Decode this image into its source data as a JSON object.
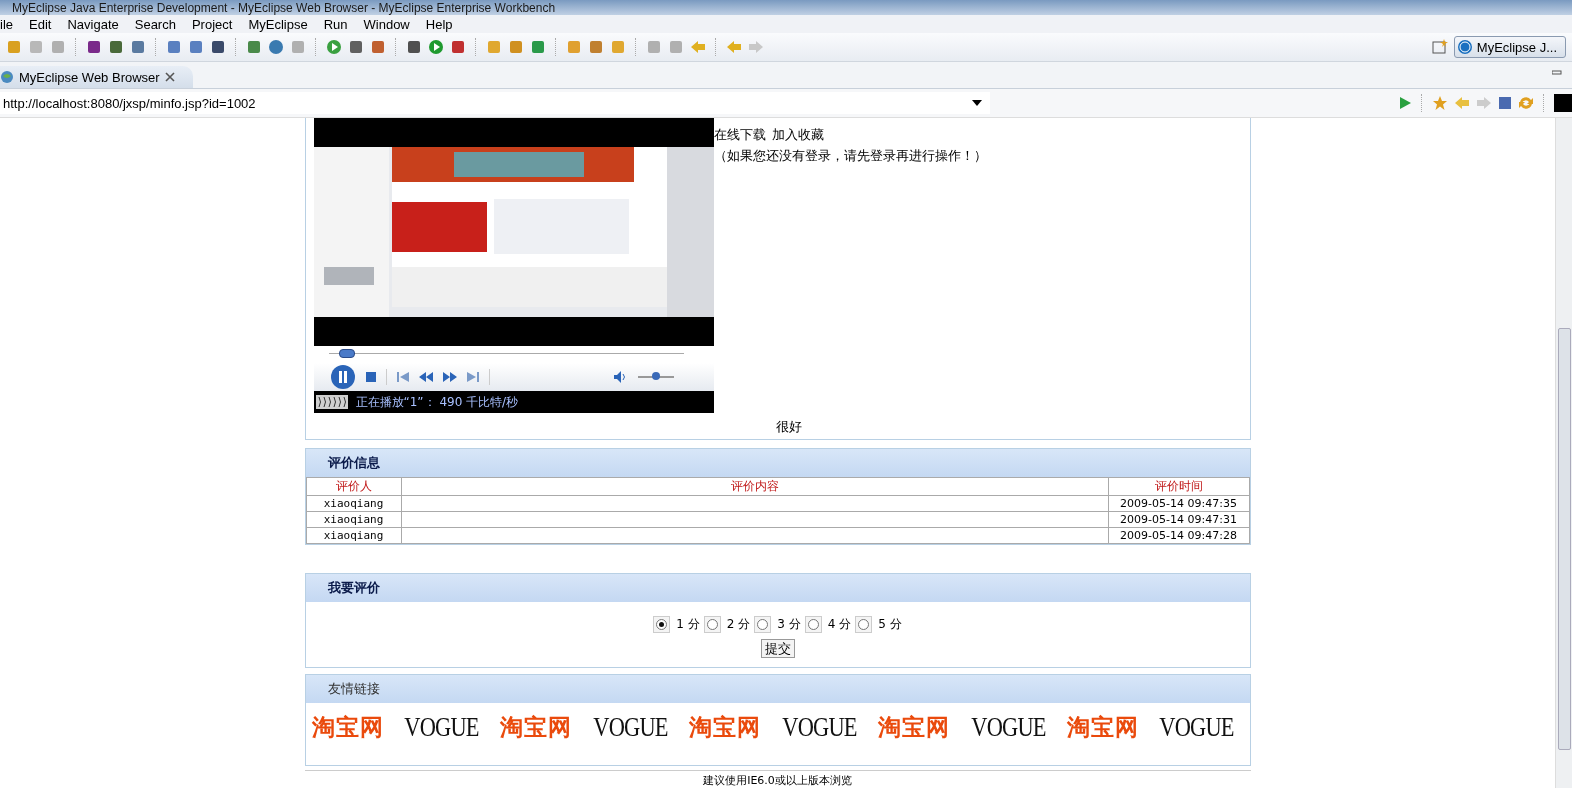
{
  "window": {
    "title": "MyEclipse Java Enterprise Development - MyEclipse Web Browser - MyEclipse Enterprise Workbench"
  },
  "menu": [
    "ile",
    "Edit",
    "Navigate",
    "Search",
    "Project",
    "MyEclipse",
    "Run",
    "Window",
    "Help"
  ],
  "perspective": {
    "label": "MyEclipse J..."
  },
  "editor_tab": {
    "label": "MyEclipse Web Browser"
  },
  "address_bar": {
    "value": "http://localhost:8080/jxsp/minfo.jsp?id=1002"
  },
  "page": {
    "actions": [
      "在线下载",
      "加入收藏"
    ],
    "login_note": "（如果您还没有登录，请先登录再进行操作！）",
    "player": {
      "playing": true,
      "seek": {
        "level": 0.03
      },
      "volume": {
        "level": 0.5
      },
      "status": "正在播放“1”： 490 千比特/秒"
    },
    "review_text": "很好",
    "reviews": {
      "title": "评价信息",
      "columns": [
        "评价人",
        "评价内容",
        "评价时间"
      ],
      "rows": [
        {
          "reviewer": "xiaoqiang",
          "time": "2009-05-14 09:47:35"
        },
        {
          "reviewer": "xiaoqiang",
          "time": "2009-05-14 09:47:31"
        },
        {
          "reviewer": "xiaoqiang",
          "time": "2009-05-14 09:47:28"
        }
      ]
    },
    "rate": {
      "title": "我要评价",
      "options": [
        {
          "label": "1 分",
          "selected": true
        },
        {
          "label": "2 分",
          "selected": false
        },
        {
          "label": "3 分",
          "selected": false
        },
        {
          "label": "4 分",
          "selected": false
        },
        {
          "label": "5 分",
          "selected": false
        }
      ],
      "submit": "提交"
    },
    "links": {
      "title": "友情链接",
      "items": [
        {
          "kind": "taobao",
          "label": "淘宝网"
        },
        {
          "kind": "vogue",
          "label": "VOGUE"
        },
        {
          "kind": "taobao",
          "label": "淘宝网"
        },
        {
          "kind": "vogue",
          "label": "VOGUE"
        },
        {
          "kind": "taobao",
          "label": "淘宝网"
        },
        {
          "kind": "vogue",
          "label": "VOGUE"
        },
        {
          "kind": "taobao",
          "label": "淘宝网"
        },
        {
          "kind": "vogue",
          "label": "VOGUE"
        },
        {
          "kind": "taobao",
          "label": "淘宝网"
        },
        {
          "kind": "vogue",
          "label": "VOGUE"
        }
      ]
    },
    "footer": "建议使用IE6.0或以上版本浏览"
  }
}
